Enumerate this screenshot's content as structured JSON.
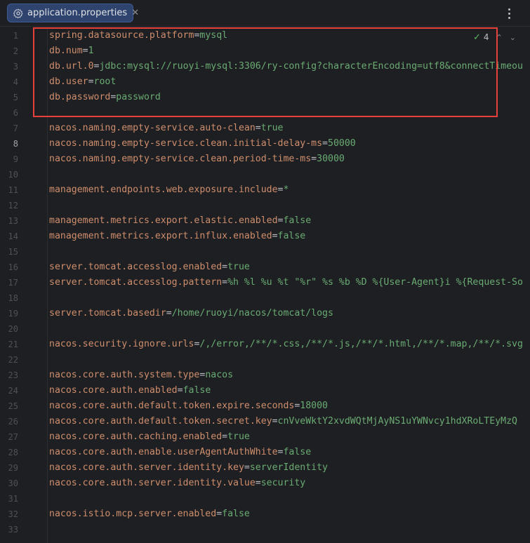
{
  "tab": {
    "title": "application.properties",
    "icon": "gear-icon",
    "close_glyph": "✕"
  },
  "toolbar": {
    "more_icon": "more-vertical-icon"
  },
  "inspection": {
    "check_glyph": "✓",
    "count": "4",
    "up_glyph": "⌃",
    "down_glyph": "⌄"
  },
  "editor": {
    "active_line": 8,
    "line_numbers": [
      "1",
      "2",
      "3",
      "4",
      "5",
      "6",
      "7",
      "8",
      "9",
      "10",
      "11",
      "12",
      "13",
      "14",
      "15",
      "16",
      "17",
      "18",
      "19",
      "20",
      "21",
      "22",
      "23",
      "24",
      "25",
      "26",
      "27",
      "28",
      "29",
      "30",
      "31",
      "32",
      "33"
    ],
    "lines": [
      {
        "key": "spring.datasource.platform",
        "value": "mysql"
      },
      {
        "key": "db.num",
        "value": "1"
      },
      {
        "key": "db.url.0",
        "value": "jdbc:mysql://ruoyi-mysql:3306/ry-config?characterEncoding=utf8&connectTimeou"
      },
      {
        "key": "db.user",
        "value": "root"
      },
      {
        "key": "db.password",
        "value": "password"
      },
      {
        "key": "",
        "value": ""
      },
      {
        "key": "nacos.naming.empty-service.auto-clean",
        "value": "true"
      },
      {
        "key": "nacos.naming.empty-service.clean.initial-delay-ms",
        "value": "50000"
      },
      {
        "key": "nacos.naming.empty-service.clean.period-time-ms",
        "value": "30000"
      },
      {
        "key": "",
        "value": ""
      },
      {
        "key": "management.endpoints.web.exposure.include",
        "value": "*"
      },
      {
        "key": "",
        "value": ""
      },
      {
        "key": "management.metrics.export.elastic.enabled",
        "value": "false"
      },
      {
        "key": "management.metrics.export.influx.enabled",
        "value": "false"
      },
      {
        "key": "",
        "value": ""
      },
      {
        "key": "server.tomcat.accesslog.enabled",
        "value": "true"
      },
      {
        "key": "server.tomcat.accesslog.pattern",
        "value": "%h %l %u %t \"%r\" %s %b %D %{User-Agent}i %{Request-So"
      },
      {
        "key": "",
        "value": ""
      },
      {
        "key": "server.tomcat.basedir",
        "value": "/home/ruoyi/nacos/tomcat/logs"
      },
      {
        "key": "",
        "value": ""
      },
      {
        "key": "nacos.security.ignore.urls",
        "value": "/,/error,/**/*.css,/**/*.js,/**/*.html,/**/*.map,/**/*.svg"
      },
      {
        "key": "",
        "value": ""
      },
      {
        "key": "nacos.core.auth.system.type",
        "value": "nacos"
      },
      {
        "key": "nacos.core.auth.enabled",
        "value": "false"
      },
      {
        "key": "nacos.core.auth.default.token.expire.seconds",
        "value": "18000"
      },
      {
        "key": "nacos.core.auth.default.token.secret.key",
        "value": "cnVveWktY2xvdWQtMjAyNS1uYWNvcy1hdXRoLTEyMzQ"
      },
      {
        "key": "nacos.core.auth.caching.enabled",
        "value": "true"
      },
      {
        "key": "nacos.core.auth.enable.userAgentAuthWhite",
        "value": "false"
      },
      {
        "key": "nacos.core.auth.server.identity.key",
        "value": "serverIdentity"
      },
      {
        "key": "nacos.core.auth.server.identity.value",
        "value": "security"
      },
      {
        "key": "",
        "value": ""
      },
      {
        "key": "nacos.istio.mcp.server.enabled",
        "value": "false"
      },
      {
        "key": "",
        "value": ""
      }
    ]
  },
  "colors": {
    "highlight_box": "#e8413b",
    "key": "#cf8e6d",
    "value": "#6aab73",
    "tab_bg": "#2e436e"
  }
}
